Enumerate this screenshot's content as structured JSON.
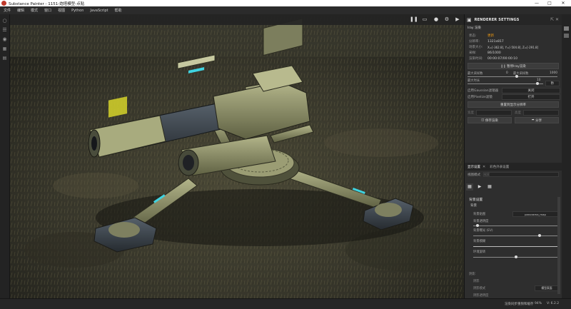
{
  "window": {
    "title": "Substance Painter - 1151-炮塔模型-点贴",
    "minimize": "—",
    "maximize": "□",
    "close": "✕"
  },
  "menu": [
    "文件",
    "编辑",
    "模式",
    "窗口",
    "视图",
    "Python",
    "JavaScript",
    "帮助"
  ],
  "left_tools": [
    "layers-icon",
    "texture-set-icon",
    "display-icon",
    "history-icon",
    "log-icon"
  ],
  "viewport_toolbar": {
    "icons": [
      "pause-icon",
      "camera-view-icon",
      "sphere-icon",
      "render-icon",
      "video-icon",
      "screenshot-icon"
    ]
  },
  "renderer": {
    "header": "RENDERER SETTINGS",
    "section": "Iray 渲染",
    "rows": [
      {
        "label": "状态:",
        "value": "更新",
        "accent": true
      },
      {
        "label": "分辨率:",
        "value": "1321x817"
      },
      {
        "label": "场景大小:",
        "value": "X=[-362.8], Y=[-504.8], Z=[-291.8]"
      },
      {
        "label": "采样:",
        "value": "86/1000"
      },
      {
        "label": "渲染时间:",
        "value": "00:00:07/00:00:10"
      }
    ],
    "pause_button": "❙❙ 暂停Iray渲染",
    "max_samples_label": "最大采样数",
    "max_samples_min": "0",
    "max_samples_label2": "最大采样数",
    "max_samples_value": "1000",
    "max_samples_fraction": 0.55,
    "max_time_label": "最大时长",
    "max_time_value": "10",
    "max_time_unit": "秒",
    "max_time_fraction": 0.92,
    "gaussian_label": "启用Gaussian滤镜器",
    "gaussian_value": "关闭",
    "pixelize_label": "启用Pixelize滤镜",
    "pixelize_value": "打开",
    "reset_button": "重置到显示分辨率",
    "width_label": "宽度",
    "height_label": "高度",
    "save_button": "保存渲染",
    "share_button": "分享"
  },
  "display": {
    "tab_active": "显示设置",
    "tab_other": "彩色外表设置",
    "search_label": "视图模式",
    "search_placeholder": "搜索",
    "section_title": "背景设置",
    "sub_title": "背景",
    "rows": [
      {
        "label": "背景贴图",
        "value": "panorama_map",
        "fraction": null
      },
      {
        "label": "背景透明度",
        "value": "",
        "fraction": 0.05
      },
      {
        "label": "背景曝光 (EV)",
        "value": "",
        "fraction": 0.78
      },
      {
        "label": "背景模糊",
        "value": "",
        "fraction": 1.0
      },
      {
        "label": "环境旋转",
        "value": "",
        "fraction": 0.5
      }
    ],
    "group2_title": "阴影",
    "group2_rows": [
      {
        "label": "阴影",
        "value": ""
      },
      {
        "label": "阴影模式",
        "value": "模型表面"
      },
      {
        "label": "阴影透明度",
        "value": ""
      }
    ]
  },
  "status": {
    "text": "渲染同步重频和缓存",
    "zoom": "94%",
    "version": "V: 6.2.2"
  },
  "colors": {
    "accent_orange": "#f39c12",
    "cyan_detail": "#3fd3e0",
    "turret_olive": "#8a8a5a",
    "panel_bg": "#2e2e2e"
  }
}
